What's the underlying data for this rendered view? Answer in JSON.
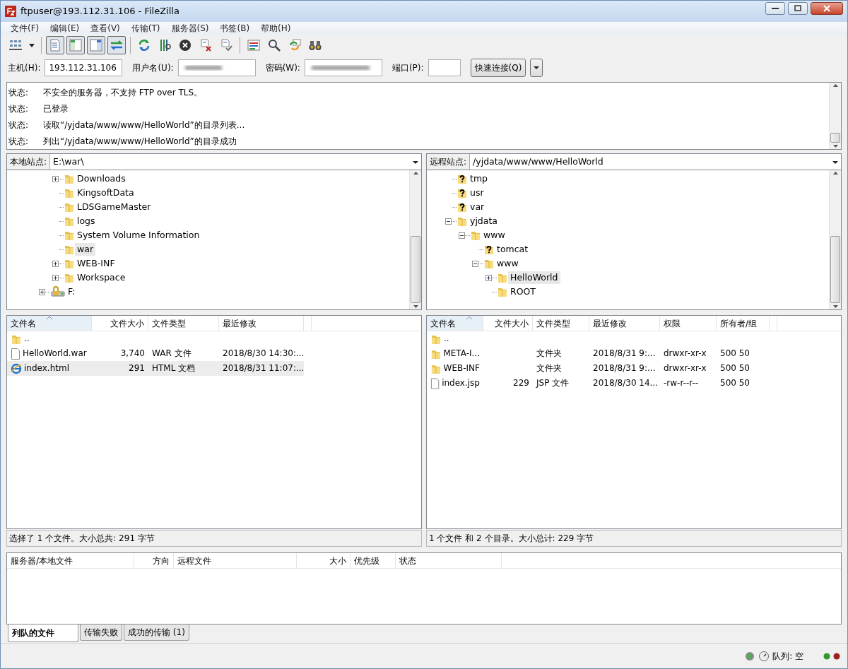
{
  "window": {
    "title": "ftpuser@193.112.31.106 - FileZilla"
  },
  "menu": [
    "文件(F)",
    "编辑(E)",
    "查看(V)",
    "传输(T)",
    "服务器(S)",
    "书签(B)",
    "帮助(H)"
  ],
  "toolbar": [
    [
      {
        "kind": "site_manager"
      },
      {
        "kind": "dropdown"
      }
    ],
    [
      {
        "kind": "log",
        "pressed": true
      },
      {
        "kind": "local_tree",
        "pressed": true
      },
      {
        "kind": "remote_tree",
        "pressed": true
      },
      {
        "kind": "queue",
        "pressed": true
      }
    ],
    [
      {
        "kind": "refresh"
      },
      {
        "kind": "filter"
      },
      {
        "kind": "cancel"
      },
      {
        "kind": "disconnect"
      },
      {
        "kind": "reconnect"
      }
    ],
    [
      {
        "kind": "compare"
      },
      {
        "kind": "search"
      },
      {
        "kind": "sync"
      },
      {
        "kind": "find"
      }
    ]
  ],
  "quickconnect": {
    "host_label": "主机(H):",
    "host": "193.112.31.106",
    "user_label": "用户名(U):",
    "password_label": "密码(W):",
    "port_label": "端口(P):",
    "button": "快速连接(Q)"
  },
  "log": [
    {
      "label": "状态:",
      "message": "不安全的服务器，不支持 FTP over TLS。"
    },
    {
      "label": "状态:",
      "message": "已登录"
    },
    {
      "label": "状态:",
      "message": "读取“/yjdata/www/www/HelloWorld”的目录列表..."
    },
    {
      "label": "状态:",
      "message": "列出“/yjdata/www/www/HelloWorld”的目录成功"
    }
  ],
  "local_site": {
    "label": "本地站点:",
    "path": "E:\\war\\"
  },
  "local_tree": [
    {
      "children": [
        {
          "label": "Downloads",
          "kind": "folder",
          "expanded": false,
          "selected": false
        },
        {
          "label": "KingsoftData",
          "kind": "folder",
          "selected": false
        },
        {
          "label": "LDSGameMaster",
          "kind": "folder",
          "selected": false
        },
        {
          "label": "logs",
          "kind": "folder",
          "selected": false
        },
        {
          "label": "System Volume Information",
          "kind": "folder",
          "selected": false
        },
        {
          "label": "war",
          "kind": "folder",
          "selected": true
        },
        {
          "label": "WEB-INF",
          "kind": "folder",
          "expanded": false,
          "selected": false
        },
        {
          "label": "Workspace",
          "kind": "folder",
          "expanded": false,
          "selected": false
        }
      ]
    },
    {
      "label": "F:",
      "kind": "drive",
      "expanded": false,
      "selected": false
    }
  ],
  "remote_site": {
    "label": "远程站点:",
    "path": "/yjdata/www/www/HelloWorld"
  },
  "remote_tree": [
    {
      "label": "tmp",
      "kind": "unknown",
      "selected": false
    },
    {
      "label": "usr",
      "kind": "unknown",
      "selected": false
    },
    {
      "label": "var",
      "kind": "unknown",
      "selected": false
    },
    {
      "label": "yjdata",
      "kind": "folder",
      "expanded": true,
      "selected": false,
      "children": [
        {
          "label": "www",
          "kind": "folder",
          "expanded": true,
          "selected": false,
          "children": [
            {
              "label": "tomcat",
              "kind": "unknown",
              "selected": false
            },
            {
              "label": "www",
              "kind": "folder",
              "expanded": true,
              "selected": false,
              "children": [
                {
                  "label": "HelloWorld",
                  "kind": "folder",
                  "expanded": false,
                  "selected": true
                },
                {
                  "label": "ROOT",
                  "kind": "folder",
                  "selected": false
                }
              ]
            }
          ]
        }
      ]
    }
  ],
  "local_files": {
    "columns": [
      {
        "label": "文件名",
        "sorted": true
      },
      {
        "label": "文件大小",
        "sorted": false
      },
      {
        "label": "文件类型",
        "sorted": false
      },
      {
        "label": "最近修改",
        "sorted": false
      }
    ],
    "rows": [
      {
        "kind": "folder",
        "cells": [
          ".."
        ],
        "selected": false
      },
      {
        "kind": "file",
        "cells": [
          "HelloWorld.war",
          "3,740",
          "WAR 文件",
          "2018/8/30 14:30:..."
        ],
        "selected": false
      },
      {
        "kind": "html",
        "cells": [
          "index.html",
          "291",
          "HTML 文档",
          "2018/8/31 11:07:..."
        ],
        "selected": true
      }
    ]
  },
  "local_status": "选择了 1 个文件。大小总共: 291 字节",
  "remote_files": {
    "columns": [
      {
        "label": "文件名",
        "sorted": true
      },
      {
        "label": "文件大小",
        "sorted": false
      },
      {
        "label": "文件类型",
        "sorted": false
      },
      {
        "label": "最近修改",
        "sorted": false
      },
      {
        "label": "权限",
        "sorted": false
      },
      {
        "label": "所有者/组",
        "sorted": false
      }
    ],
    "rows": [
      {
        "kind": "folder",
        "cells": [
          ".."
        ],
        "selected": false
      },
      {
        "kind": "folder",
        "cells": [
          "META-I...",
          "",
          "文件夹",
          "2018/8/31 9:...",
          "drwxr-xr-x",
          "500 50"
        ],
        "selected": false
      },
      {
        "kind": "folder",
        "cells": [
          "WEB-INF",
          "",
          "文件夹",
          "2018/8/31 9:...",
          "drwxr-xr-x",
          "500 50"
        ],
        "selected": false
      },
      {
        "kind": "file",
        "cells": [
          "index.jsp",
          "229",
          "JSP 文件",
          "2018/8/30 14...",
          "-rw-r--r--",
          "500 50"
        ],
        "selected": false
      }
    ]
  },
  "remote_status": "1 个文件 和 2 个目录。大小总计: 229 字节",
  "queue": {
    "columns": [
      "服务器/本地文件",
      "方向",
      "远程文件",
      "大小",
      "优先级",
      "状态"
    ]
  },
  "queue_tabs": [
    {
      "label": "列队的文件",
      "selected": true
    },
    {
      "label": "传输失败",
      "selected": false
    },
    {
      "label": "成功的传输 (1)",
      "selected": false
    }
  ],
  "status_bar": {
    "queue": "队列: 空"
  }
}
